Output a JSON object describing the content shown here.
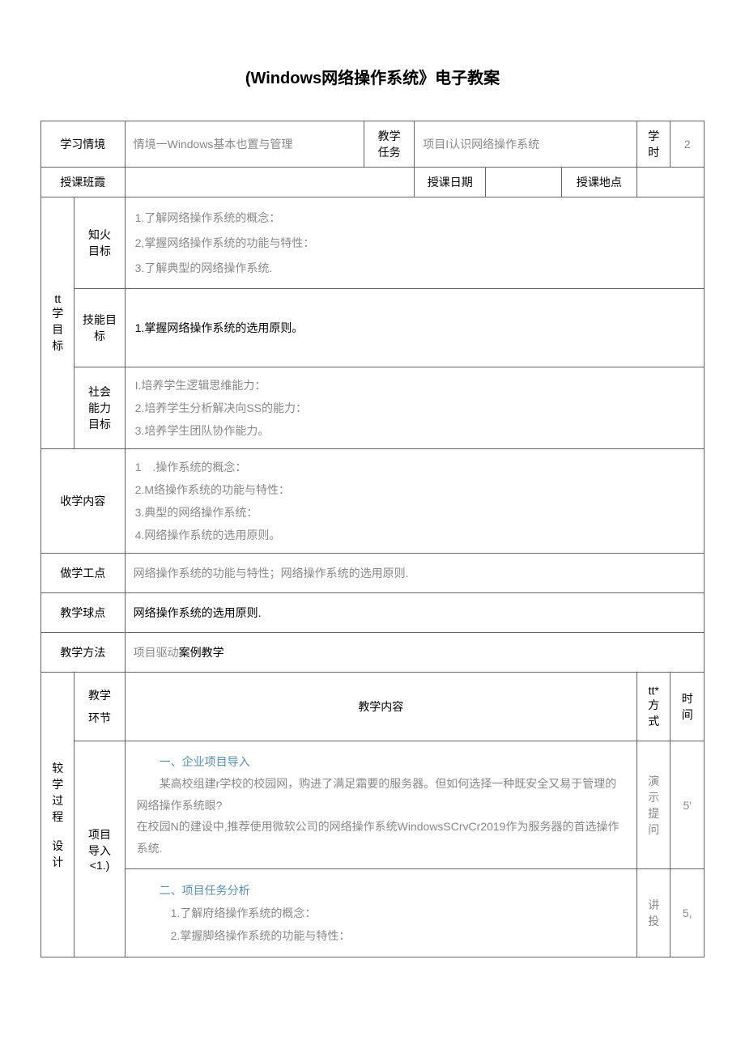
{
  "title": "(Windows网络操作系统》电子教案",
  "header": {
    "context_label": "学习情境",
    "context_value": "情境一Windows基本也置与管理",
    "task_label": "教学任务",
    "task_value": "项目I认识网络操作系统",
    "hours_label": "学时",
    "hours_value": "2",
    "class_label": "授课班霞",
    "date_label": "授课日期",
    "place_label": "授课地点"
  },
  "objectives": {
    "main_label": "tt学目标",
    "knowledge_label": "知火\n目标",
    "knowledge_text": "1.了解网络操作系统的概念：\n2,掌握网络操作系统的功能与特性：\n3.了解典型的网络操作系统.",
    "skill_label": "技能目标",
    "skill_text": "1.掌握网络操作系统的选用原则。",
    "social_label": "社会能力目标",
    "social_text": "I.培养学生逻辑思维能力：\n2.培养学生分析解决向SS的能力：\n3.培养学生团队协作能力。"
  },
  "content": {
    "label": "收学内容",
    "text": "1　.操作系统的概念：\n2.M络操作系统的功能与特性：\n3.典型的网络操作系统：\n4.网络操作系统的选用原则。"
  },
  "keypoint": {
    "label": "做学工点",
    "text": "网络操作系统的功能与特性；网络操作系统的选用原则."
  },
  "difficulty": {
    "label": "教学球点",
    "text": "网络操作系统的选用原则."
  },
  "method": {
    "label": "教学方法",
    "text_gray": "项目驱动",
    "text_black": "案例教学"
  },
  "process": {
    "main_label": "较学过程\n\n设计",
    "segment_label": "教学\n环节",
    "content_label": "教学内容",
    "mode_label": "tt*方式",
    "time_label": "时间",
    "intro_label": "项目导入\n<1.)",
    "intro1_header": "一、企业项目导入",
    "intro1_body": "某高校组建r学校的校园网，购进了满足霜要的服务器。但如何选择一种既安全又易于管理的网络操作系统眼?\n在校园N的建设中,推荐使用微软公司的网络操作系统WindowsSCrvCr2019作为服务器的首选操作系统.",
    "intro1_mode": "演示提问",
    "intro1_time": "5'",
    "intro2_header": "二、项目任务分析",
    "intro2_body": "1.了解府络操作系统的概念：\n2.掌握脚络操作系统的功能与特性：",
    "intro2_mode": "讲投",
    "intro2_time": "5,"
  }
}
